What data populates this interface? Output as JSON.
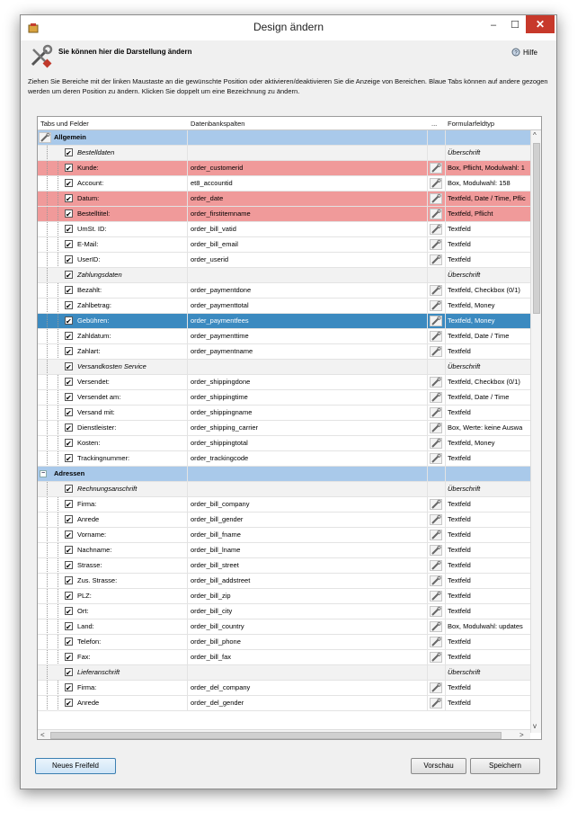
{
  "window": {
    "title": "Design ändern",
    "minimize": "–",
    "maximize": "☐",
    "close": "✕"
  },
  "header": {
    "title": "Sie können hier die Darstellung ändern",
    "help": "Hilfe",
    "description": "Ziehen Sie Bereiche mit der linken Maustaste an die gewünschte Position oder aktivieren/deaktivieren Sie die Anzeige von Bereichen. Blaue Tabs können auf andere gezogen werden um deren Position zu ändern. Klicken Sie doppelt um eine Bezeichnung zu ändern."
  },
  "grid": {
    "columns": [
      "Tabs und Felder",
      "Datenbankspalten",
      "...",
      "Formularfeldtyp"
    ],
    "rows": [
      {
        "type": "cat",
        "expand": "",
        "label": "Allgemein",
        "db": "",
        "ftype": ""
      },
      {
        "type": "sub",
        "label": "Bestelldaten",
        "db": "",
        "ftype": "Überschrift"
      },
      {
        "type": "req",
        "label": "Kunde:",
        "db": "order_customerid",
        "ftype": "Box, Pflicht, Modulwahl: 1"
      },
      {
        "type": "field",
        "label": "Account:",
        "db": "et8_accountid",
        "ftype": "Box, Modulwahl: 158"
      },
      {
        "type": "req",
        "label": "Datum:",
        "db": "order_date",
        "ftype": "Textfeld, Date / Time, Pflic"
      },
      {
        "type": "req",
        "label": "Bestelltitel:",
        "db": "order_firstitemname",
        "ftype": "Textfeld, Pflicht"
      },
      {
        "type": "field",
        "label": "UmSt. ID:",
        "db": "order_bill_vatid",
        "ftype": "Textfeld"
      },
      {
        "type": "field",
        "label": "E-Mail:",
        "db": "order_bill_email",
        "ftype": "Textfeld"
      },
      {
        "type": "field",
        "label": "UserID:",
        "db": "order_userid",
        "ftype": "Textfeld"
      },
      {
        "type": "sub",
        "label": "Zahlungsdaten",
        "db": "",
        "ftype": "Überschrift"
      },
      {
        "type": "field",
        "label": "Bezahlt:",
        "db": "order_paymentdone",
        "ftype": "Textfeld, Checkbox (0/1)"
      },
      {
        "type": "field",
        "label": "Zahlbetrag:",
        "db": "order_paymenttotal",
        "ftype": "Textfeld, Money"
      },
      {
        "type": "sel",
        "label": "Gebühren:",
        "db": "order_paymentfees",
        "ftype": "Textfeld, Money"
      },
      {
        "type": "field",
        "label": "Zahldatum:",
        "db": "order_paymenttime",
        "ftype": "Textfeld, Date / Time"
      },
      {
        "type": "field",
        "label": "Zahlart:",
        "db": "order_paymentname",
        "ftype": "Textfeld"
      },
      {
        "type": "sub",
        "label": "Versandkosten Service",
        "db": "",
        "ftype": "Überschrift"
      },
      {
        "type": "field",
        "label": "Versendet:",
        "db": "order_shippingdone",
        "ftype": "Textfeld, Checkbox (0/1)"
      },
      {
        "type": "field",
        "label": "Versendet am:",
        "db": "order_shippingtime",
        "ftype": "Textfeld, Date / Time"
      },
      {
        "type": "field",
        "label": "Versand mit:",
        "db": "order_shippingname",
        "ftype": "Textfeld"
      },
      {
        "type": "field",
        "label": "Dienstleister:",
        "db": "order_shipping_carrier",
        "ftype": "Box, Werte: keine Auswa"
      },
      {
        "type": "field",
        "label": "Kosten:",
        "db": "order_shippingtotal",
        "ftype": "Textfeld, Money"
      },
      {
        "type": "field",
        "label": "Trackingnummer:",
        "db": "order_trackingcode",
        "ftype": "Textfeld"
      },
      {
        "type": "cat",
        "expand": "−",
        "label": "Adressen",
        "db": "",
        "ftype": ""
      },
      {
        "type": "sub",
        "label": "Rechnungsanschrift",
        "db": "",
        "ftype": "Überschrift"
      },
      {
        "type": "field",
        "label": "Firma:",
        "db": "order_bill_company",
        "ftype": "Textfeld"
      },
      {
        "type": "field",
        "label": "Anrede",
        "db": "order_bill_gender",
        "ftype": "Textfeld"
      },
      {
        "type": "field",
        "label": "Vorname:",
        "db": "order_bill_fname",
        "ftype": "Textfeld"
      },
      {
        "type": "field",
        "label": "Nachname:",
        "db": "order_bill_lname",
        "ftype": "Textfeld"
      },
      {
        "type": "field",
        "label": "Strasse:",
        "db": "order_bill_street",
        "ftype": "Textfeld"
      },
      {
        "type": "field",
        "label": "Zus. Strasse:",
        "db": "order_bill_addstreet",
        "ftype": "Textfeld"
      },
      {
        "type": "field",
        "label": "PLZ:",
        "db": "order_bill_zip",
        "ftype": "Textfeld"
      },
      {
        "type": "field",
        "label": "Ort:",
        "db": "order_bill_city",
        "ftype": "Textfeld"
      },
      {
        "type": "field",
        "label": "Land:",
        "db": "order_bill_country",
        "ftype": "Box, Modulwahl: updates"
      },
      {
        "type": "field",
        "label": "Telefon:",
        "db": "order_bill_phone",
        "ftype": "Textfeld"
      },
      {
        "type": "field",
        "label": "Fax:",
        "db": "order_bill_fax",
        "ftype": "Textfeld"
      },
      {
        "type": "sub",
        "label": "Lieferanschrift",
        "db": "",
        "ftype": "Überschrift"
      },
      {
        "type": "field",
        "label": "Firma:",
        "db": "order_del_company",
        "ftype": "Textfeld"
      },
      {
        "type": "field",
        "label": "Anrede",
        "db": "order_del_gender",
        "ftype": "Textfeld"
      }
    ]
  },
  "buttons": {
    "new_field": "Neues Freifeld",
    "preview": "Vorschau",
    "save": "Speichern"
  },
  "colors": {
    "category": "#a9c9ea",
    "required": "#f09a9a",
    "selected": "#3b8ac0",
    "close": "#c7392b"
  },
  "icons": {
    "app": "app-icon",
    "tools": "tools-icon",
    "help": "help-icon",
    "edit": "pencil-icon"
  }
}
